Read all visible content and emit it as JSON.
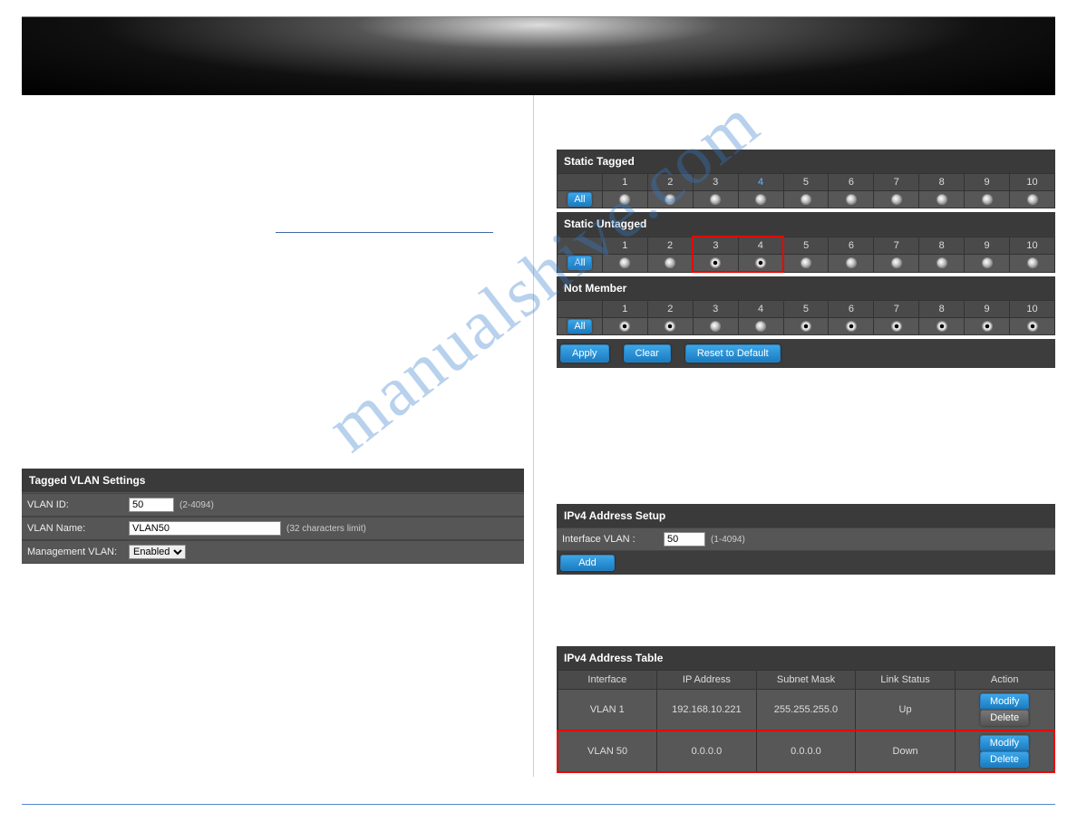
{
  "watermark": "manualshive.com",
  "tagged_settings": {
    "title": "Tagged VLAN Settings",
    "vlan_id_label": "VLAN ID:",
    "vlan_id_value": "50",
    "vlan_id_hint": "(2-4094)",
    "vlan_name_label": "VLAN Name:",
    "vlan_name_value": "VLAN50",
    "vlan_name_hint": "(32 characters limit)",
    "mgmt_label": "Management VLAN:",
    "mgmt_value": "Enabled"
  },
  "port_sections": {
    "static_tagged": {
      "title": "Static Tagged",
      "columns": [
        "1",
        "2",
        "3",
        "4",
        "5",
        "6",
        "7",
        "8",
        "9",
        "10"
      ],
      "all_label": "All",
      "highlight_col": 4,
      "selected": []
    },
    "static_untagged": {
      "title": "Static Untagged",
      "columns": [
        "1",
        "2",
        "3",
        "4",
        "5",
        "6",
        "7",
        "8",
        "9",
        "10"
      ],
      "all_label": "All",
      "highlight_cols": [
        3,
        4
      ],
      "selected": [
        3,
        4
      ]
    },
    "not_member": {
      "title": "Not Member",
      "columns": [
        "1",
        "2",
        "3",
        "4",
        "5",
        "6",
        "7",
        "8",
        "9",
        "10"
      ],
      "all_label": "All",
      "selected": [
        1,
        2,
        5,
        6,
        7,
        8,
        9,
        10
      ]
    },
    "buttons": {
      "apply": "Apply",
      "clear": "Clear",
      "reset": "Reset to Default"
    }
  },
  "ipv4_setup": {
    "title": "IPv4 Address Setup",
    "iface_label": "Interface VLAN :",
    "iface_value": "50",
    "iface_hint": "(1-4094)",
    "add_label": "Add"
  },
  "ipv4_table": {
    "title": "IPv4 Address Table",
    "headers": [
      "Interface",
      "IP Address",
      "Subnet Mask",
      "Link Status",
      "Action"
    ],
    "rows": [
      {
        "interface": "VLAN 1",
        "ip": "192.168.10.221",
        "mask": "255.255.255.0",
        "status": "Up",
        "modify": "Modify",
        "delete": "Delete",
        "delete_disabled": true,
        "highlight": false
      },
      {
        "interface": "VLAN 50",
        "ip": "0.0.0.0",
        "mask": "0.0.0.0",
        "status": "Down",
        "modify": "Modify",
        "delete": "Delete",
        "delete_disabled": false,
        "highlight": true
      }
    ]
  }
}
